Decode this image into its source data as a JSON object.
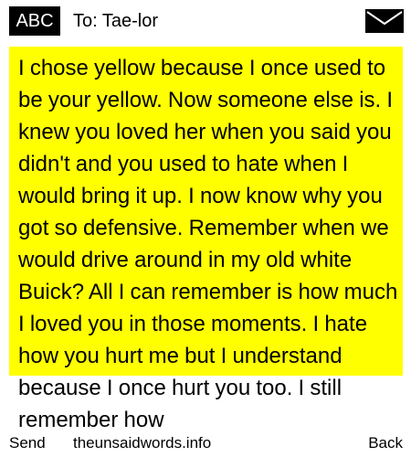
{
  "header": {
    "mode_label": "ABC",
    "recipient": "To: Tae-lor",
    "envelope_icon": "envelope-icon"
  },
  "message": {
    "body": "I chose yellow because I once used to be your yellow. Now someone else is. I knew you loved her when you said you didn't and you used to hate when I would bring it up. I now know why you got so defensive. Remember when we would drive around in my old white Buick? All I can remember is how much I loved you in those moments. I hate how you hurt me but I understand because I once hurt you too. I still remember how"
  },
  "softkeys": {
    "left": "Send",
    "center": "theunsaidwords.info",
    "right": "Back"
  },
  "colors": {
    "highlight": "#ffff00",
    "badge_bg": "#000000",
    "badge_text": "#ffffff"
  }
}
